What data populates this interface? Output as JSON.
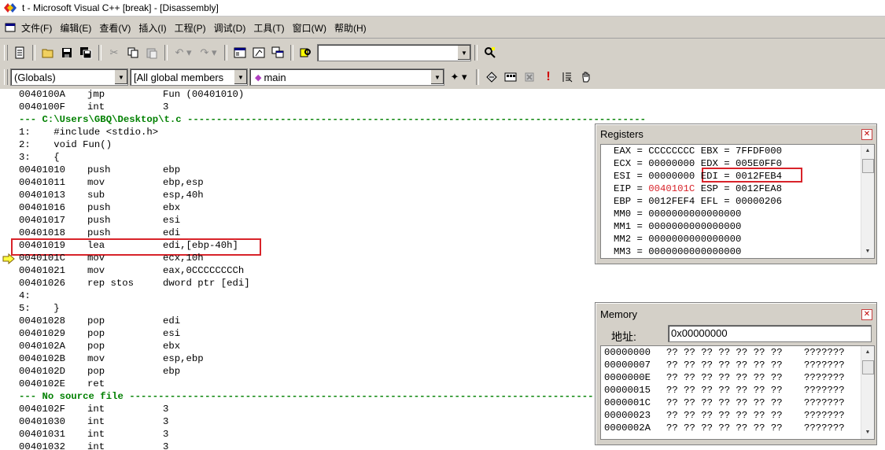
{
  "window": {
    "title": "t - Microsoft Visual C++ [break] - [Disassembly]"
  },
  "menu": [
    "文件(F)",
    "编辑(E)",
    "查看(V)",
    "插入(I)",
    "工程(P)",
    "调试(D)",
    "工具(T)",
    "窗口(W)",
    "帮助(H)"
  ],
  "combos": {
    "globals": "(Globals)",
    "members": "[All global members",
    "function": "main"
  },
  "code": [
    {
      "t": "asm",
      "a": "0040100A",
      "m": "jmp",
      "o": "Fun (00401010)"
    },
    {
      "t": "asm",
      "a": "0040100F",
      "m": "int",
      "o": "3"
    },
    {
      "t": "sep",
      "text": "--- C:\\Users\\GBQ\\Desktop\\t.c -------------------------------------------------------------------------------"
    },
    {
      "t": "src",
      "text": "1:    #include <stdio.h>"
    },
    {
      "t": "src",
      "text": "2:    void Fun()"
    },
    {
      "t": "src",
      "text": "3:    {"
    },
    {
      "t": "asm",
      "a": "00401010",
      "m": "push",
      "o": "ebp"
    },
    {
      "t": "asm",
      "a": "00401011",
      "m": "mov",
      "o": "ebp,esp"
    },
    {
      "t": "asm",
      "a": "00401013",
      "m": "sub",
      "o": "esp,40h"
    },
    {
      "t": "asm",
      "a": "00401016",
      "m": "push",
      "o": "ebx"
    },
    {
      "t": "asm",
      "a": "00401017",
      "m": "push",
      "o": "esi"
    },
    {
      "t": "asm",
      "a": "00401018",
      "m": "push",
      "o": "edi"
    },
    {
      "t": "asm",
      "a": "00401019",
      "m": "lea",
      "o": "edi,[ebp-40h]"
    },
    {
      "t": "asm",
      "a": "0040101C",
      "m": "mov",
      "o": "ecx,10h"
    },
    {
      "t": "asm",
      "a": "00401021",
      "m": "mov",
      "o": "eax,0CCCCCCCCh"
    },
    {
      "t": "asm",
      "a": "00401026",
      "m": "rep stos",
      "o": "dword ptr [edi]"
    },
    {
      "t": "src",
      "text": "4:"
    },
    {
      "t": "src",
      "text": "5:    }"
    },
    {
      "t": "asm",
      "a": "00401028",
      "m": "pop",
      "o": "edi"
    },
    {
      "t": "asm",
      "a": "00401029",
      "m": "pop",
      "o": "esi"
    },
    {
      "t": "asm",
      "a": "0040102A",
      "m": "pop",
      "o": "ebx"
    },
    {
      "t": "asm",
      "a": "0040102B",
      "m": "mov",
      "o": "esp,ebp"
    },
    {
      "t": "asm",
      "a": "0040102D",
      "m": "pop",
      "o": "ebp"
    },
    {
      "t": "asm",
      "a": "0040102E",
      "m": "ret",
      "o": ""
    },
    {
      "t": "sep",
      "text": "--- No source file ----------------------------------------------------------------------------------------"
    },
    {
      "t": "asm",
      "a": "0040102F",
      "m": "int",
      "o": "3"
    },
    {
      "t": "asm",
      "a": "00401030",
      "m": "int",
      "o": "3"
    },
    {
      "t": "asm",
      "a": "00401031",
      "m": "int",
      "o": "3"
    },
    {
      "t": "asm",
      "a": "00401032",
      "m": "int",
      "o": "3"
    }
  ],
  "registers": {
    "title": "Registers",
    "rows": [
      "EAX = CCCCCCCC EBX = 7FFDF000",
      "ECX = 00000000 EDX = 005E0FF0",
      "ESI = 00000000 ",
      "EIP = ",
      "EBP = 0012FEF4 EFL = 00000206",
      "MM0 = 0000000000000000",
      "MM1 = 0000000000000000",
      "MM2 = 0000000000000000",
      "MM3 = 0000000000000000"
    ],
    "edi": "EDI = 0012FEB4",
    "eip_val": "0040101C",
    "esp": " ESP = 0012FEA8"
  },
  "memory": {
    "title": "Memory",
    "addr_label": "地址:",
    "addr_value": "0x00000000",
    "rows": [
      {
        "a": "00000000",
        "b": "?? ?? ?? ?? ?? ?? ??",
        "c": "???????"
      },
      {
        "a": "00000007",
        "b": "?? ?? ?? ?? ?? ?? ??",
        "c": "???????"
      },
      {
        "a": "0000000E",
        "b": "?? ?? ?? ?? ?? ?? ??",
        "c": "???????"
      },
      {
        "a": "00000015",
        "b": "?? ?? ?? ?? ?? ?? ??",
        "c": "???????"
      },
      {
        "a": "0000001C",
        "b": "?? ?? ?? ?? ?? ?? ??",
        "c": "???????"
      },
      {
        "a": "00000023",
        "b": "?? ?? ?? ?? ?? ?? ??",
        "c": "???????"
      },
      {
        "a": "0000002A",
        "b": "?? ?? ?? ?? ?? ?? ??",
        "c": "???????"
      }
    ]
  },
  "colors": {
    "highlight": "#d8232a",
    "separator": "#008000"
  }
}
